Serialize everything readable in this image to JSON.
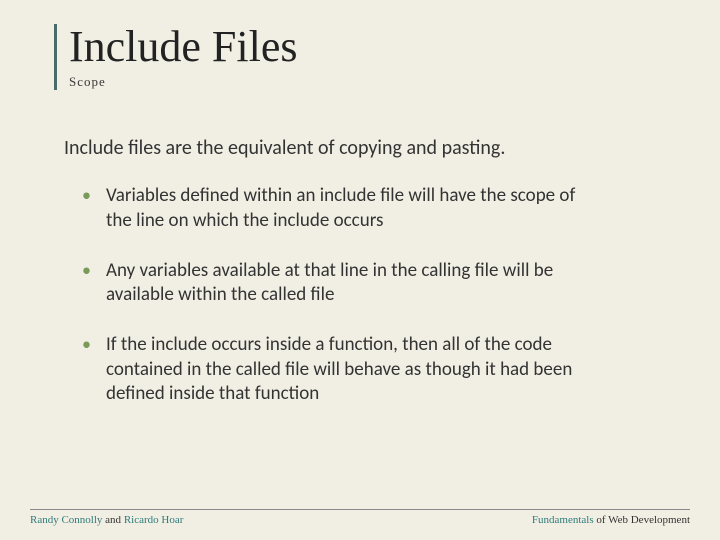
{
  "title": "Include Files",
  "subtitle": "Scope",
  "intro": "Include files are the equivalent of copying and pasting.",
  "bullets": [
    "Variables defined within an include file will have the scope of the line on which the include occurs",
    "Any variables available at that line in the calling file will be available within the called file",
    "If the include occurs inside a function, then all of the code contained in the called file will behave as though it had been defined inside that function"
  ],
  "footer": {
    "left_a": "Randy Connolly ",
    "left_mid": "and ",
    "left_b": "Ricardo Hoar",
    "right_a": "Fundamentals ",
    "right_b": "of Web Development"
  }
}
